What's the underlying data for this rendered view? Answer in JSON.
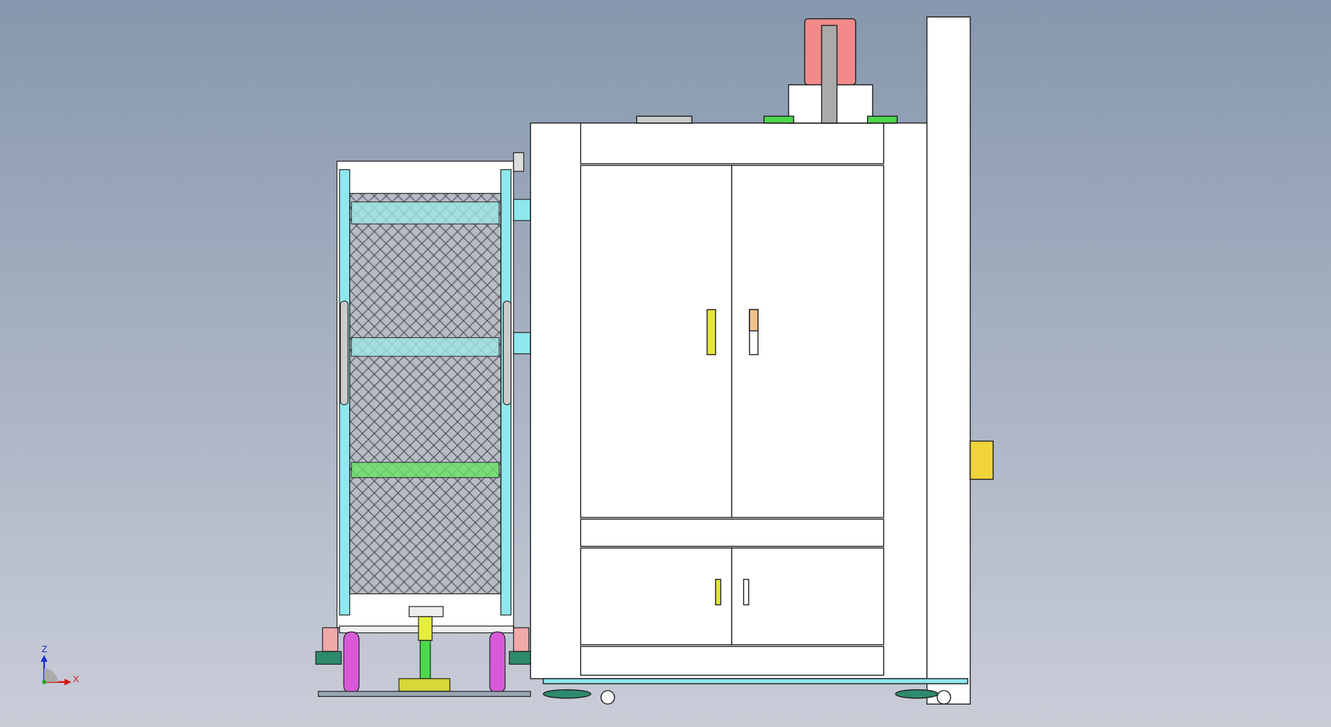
{
  "viewport": {
    "axis_triad": {
      "z_label": "Z",
      "x_label": "X"
    }
  }
}
